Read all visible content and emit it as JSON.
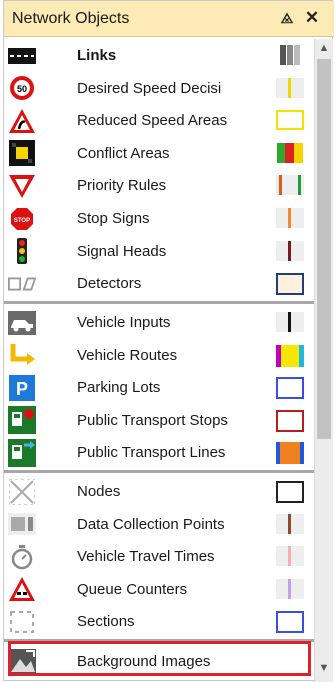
{
  "panel": {
    "title": "Network Objects",
    "pin_glyph": "⨻",
    "close_glyph": "✕"
  },
  "items": [
    {
      "label": "Links",
      "bold": true,
      "icon": "links-icon"
    },
    {
      "label": "Desired Speed Decisi",
      "icon": "speed-limit-50-icon"
    },
    {
      "label": "Reduced Speed Areas",
      "icon": "curve-warning-icon"
    },
    {
      "label": "Conflict Areas",
      "icon": "conflict-area-icon"
    },
    {
      "label": "Priority Rules",
      "icon": "yield-sign-icon"
    },
    {
      "label": "Stop Signs",
      "icon": "stop-sign-icon"
    },
    {
      "label": "Signal Heads",
      "icon": "traffic-light-icon"
    },
    {
      "label": "Detectors",
      "icon": "detector-icon"
    },
    {
      "label": "Vehicle Inputs",
      "icon": "vehicle-input-icon"
    },
    {
      "label": "Vehicle Routes",
      "icon": "route-arrow-icon"
    },
    {
      "label": "Parking Lots",
      "icon": "parking-icon"
    },
    {
      "label": "Public Transport Stops",
      "icon": "transit-stop-icon"
    },
    {
      "label": "Public Transport Lines",
      "icon": "transit-line-icon"
    },
    {
      "label": "Nodes",
      "icon": "node-icon"
    },
    {
      "label": "Data Collection Points",
      "icon": "data-collection-icon"
    },
    {
      "label": "Vehicle Travel Times",
      "icon": "stopwatch-icon"
    },
    {
      "label": "Queue Counters",
      "icon": "queue-counter-icon"
    },
    {
      "label": "Sections",
      "icon": "section-icon"
    },
    {
      "label": "Background Images",
      "icon": "background-image-icon"
    }
  ],
  "colors": {
    "titlebar_bg": "#fcebb5",
    "highlight": "#e0202a",
    "scroll_thumb": "#c2c2c2"
  }
}
